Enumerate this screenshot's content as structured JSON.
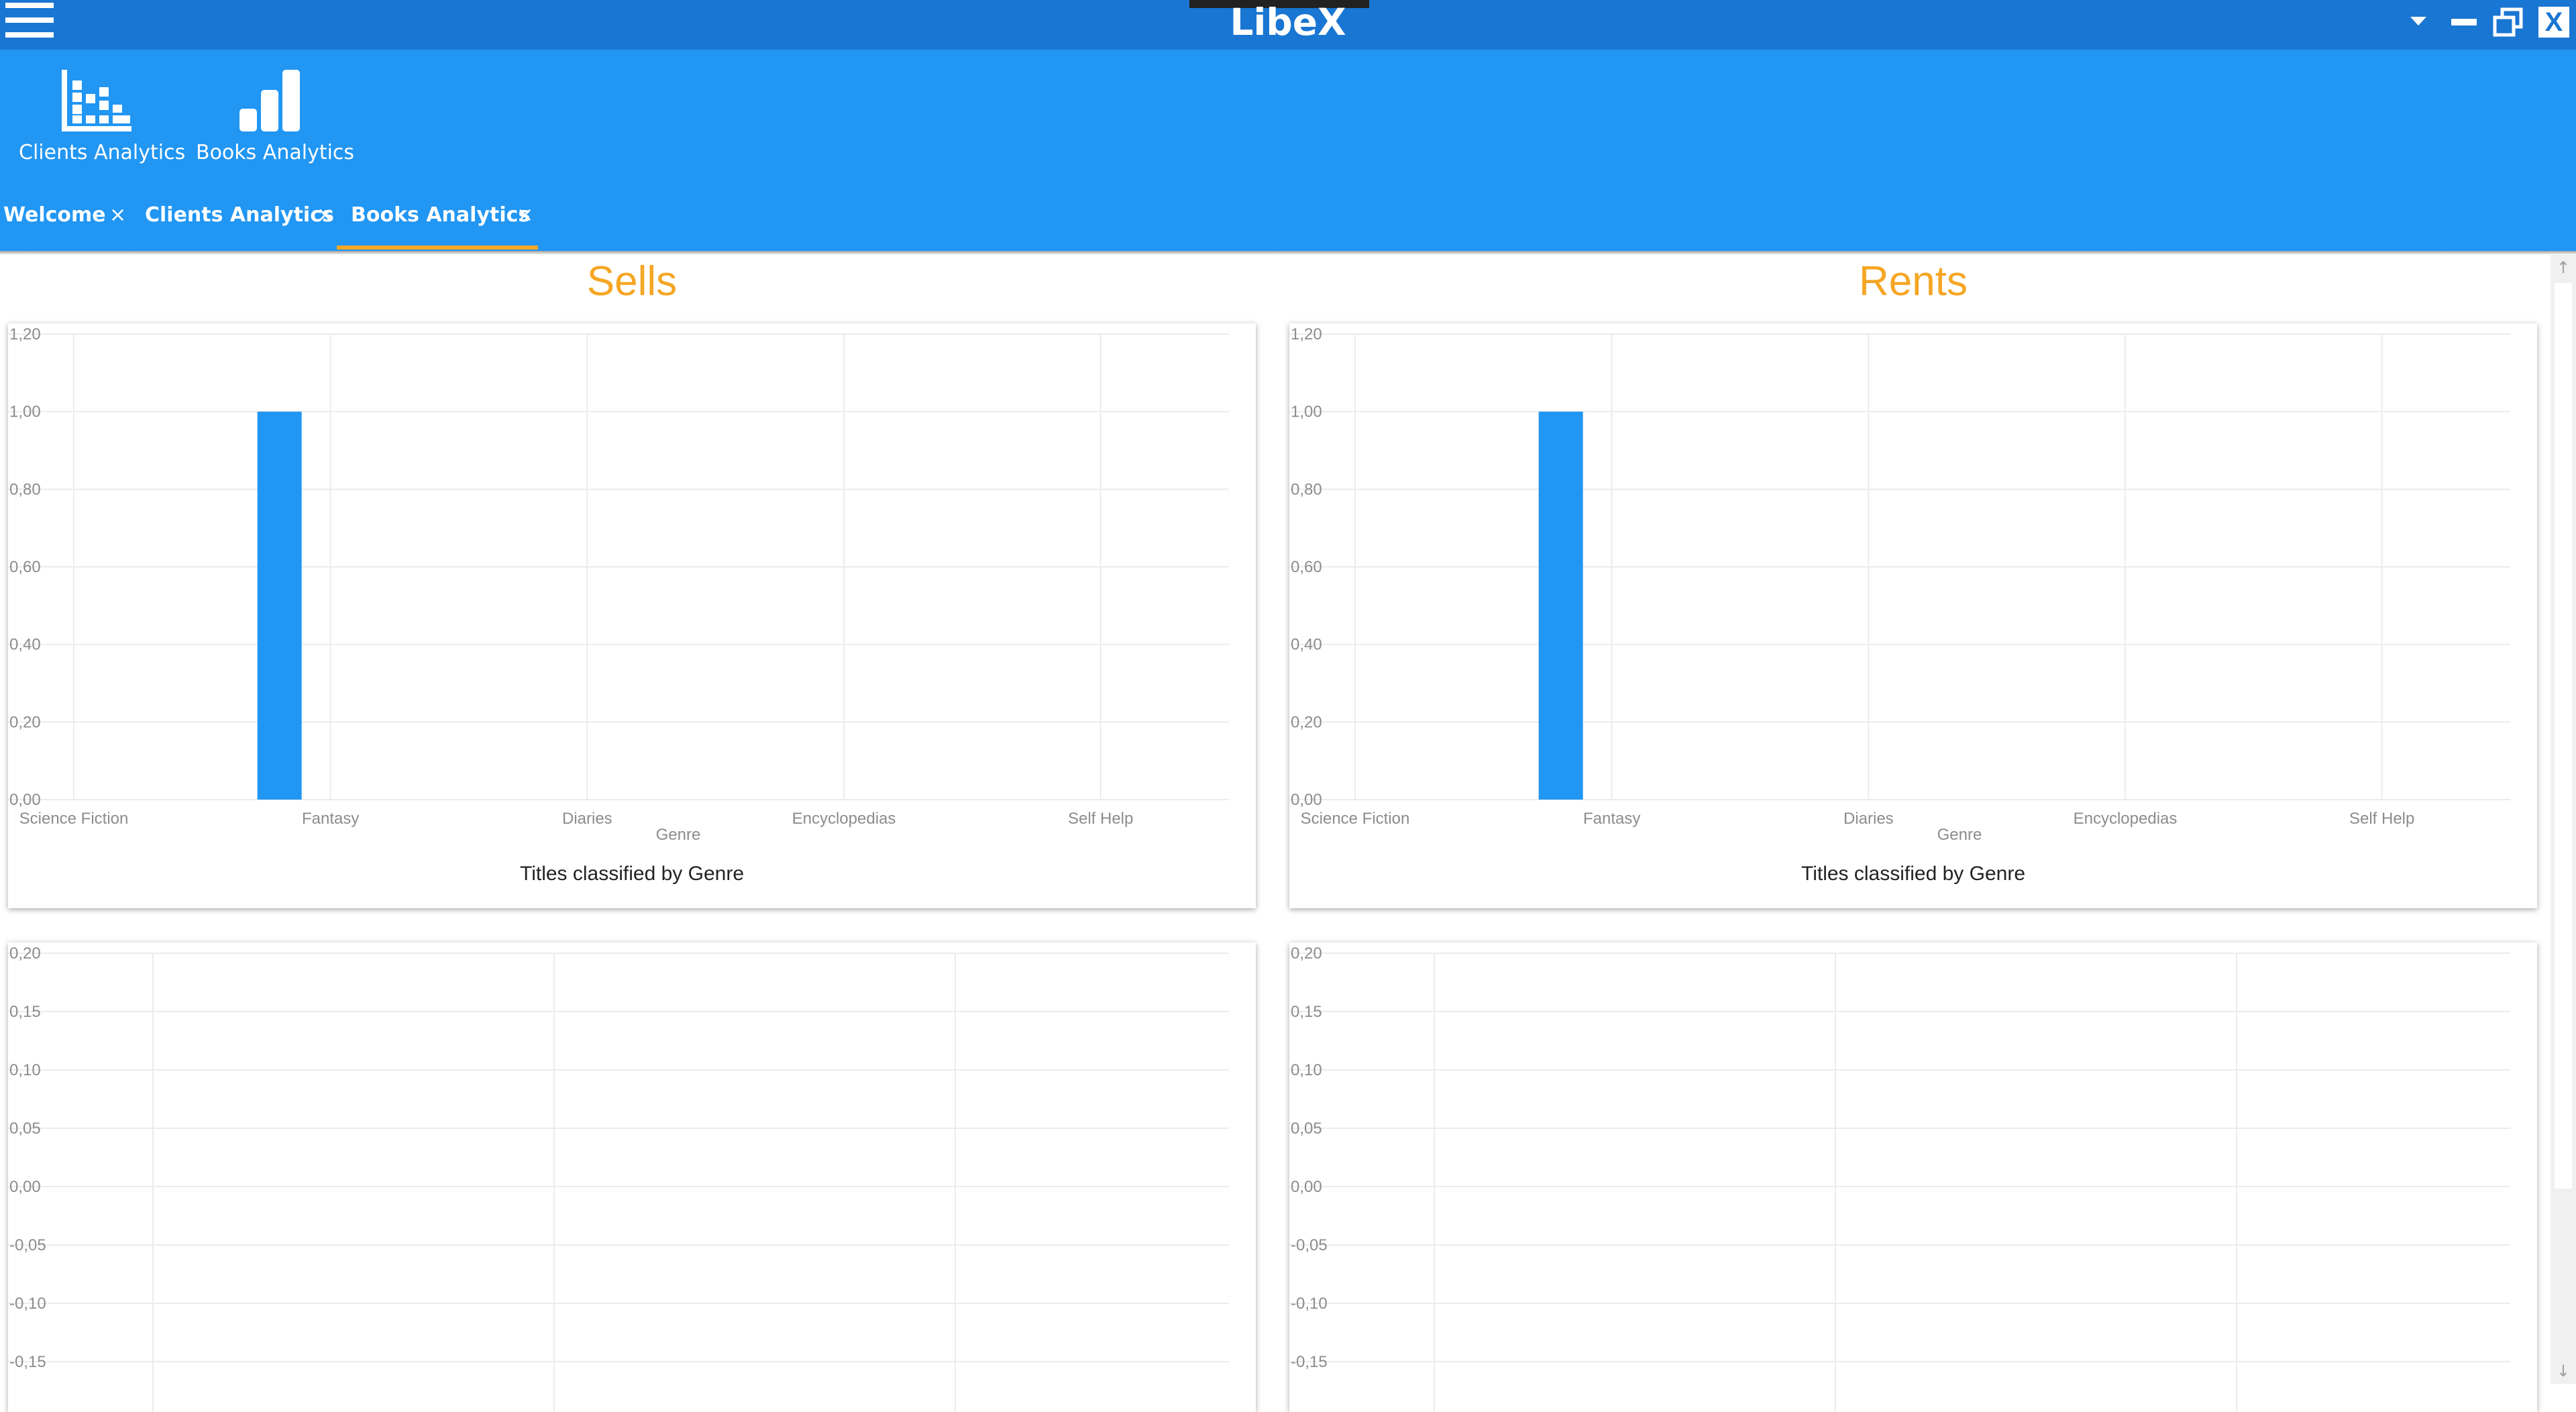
{
  "window": {
    "title": "LibeX",
    "menu_icon": "hamburger-menu-icon",
    "controls": [
      "chevron-down-icon",
      "minimize-icon",
      "restore-icon",
      "close-icon"
    ],
    "close_label": "X"
  },
  "ribbon": {
    "buttons": [
      {
        "label": "Clients Analytics",
        "icon": "bar-chart-icon"
      },
      {
        "label": "Books Analytics",
        "icon": "bar-chart-ascending-icon"
      }
    ]
  },
  "tabs": [
    {
      "label": "Welcome",
      "close": "×"
    },
    {
      "label": "Clients Analytics",
      "close": "×"
    },
    {
      "label": "Books Analytics",
      "close": "×",
      "active": true
    }
  ],
  "colors": {
    "titlebar": "#1976d2",
    "ribbon": "#2196f3",
    "accent": "#f9a825",
    "section_title": "#f5a623",
    "bar": "#2196f3"
  },
  "sections": {
    "left_title": "Sells",
    "right_title": "Rents"
  },
  "chart_data": [
    {
      "type": "bar",
      "categories": [
        "Science Fiction",
        "Fantasy",
        "Diaries",
        "Encyclopedias",
        "Self Help"
      ],
      "values": [
        1.0,
        0,
        0,
        0,
        0
      ],
      "bar_category_index": 1,
      "xlabel": "Genre",
      "caption": "Titles classified by Genre",
      "ylim": [
        0,
        1.2
      ],
      "yticks": [
        "0,00",
        "0,20",
        "0,40",
        "0,60",
        "0,80",
        "1,00",
        "1,20"
      ],
      "grid": true
    },
    {
      "type": "bar",
      "categories": [
        "Science Fiction",
        "Fantasy",
        "Diaries",
        "Encyclopedias",
        "Self Help"
      ],
      "values": [
        1.0,
        0,
        0,
        0,
        0
      ],
      "bar_category_index": 1,
      "xlabel": "Genre",
      "caption": "Titles classified by Genre",
      "ylim": [
        0,
        1.2
      ],
      "yticks": [
        "0,00",
        "0,20",
        "0,40",
        "0,60",
        "0,80",
        "1,00",
        "1,20"
      ],
      "grid": true
    },
    {
      "type": "bar",
      "categories": [],
      "values": [],
      "ylim": [
        -0.15,
        0.2
      ],
      "yticks": [
        "0,20",
        "0,15",
        "0,10",
        "0,05",
        "0,00",
        "-0,05",
        "-0,10",
        "-0,15"
      ],
      "grid": true
    },
    {
      "type": "bar",
      "categories": [],
      "values": [],
      "ylim": [
        -0.15,
        0.2
      ],
      "yticks": [
        "0,20",
        "0,15",
        "0,10",
        "0,05",
        "0,00",
        "-0,05",
        "-0,10",
        "-0,15"
      ],
      "grid": true
    }
  ]
}
